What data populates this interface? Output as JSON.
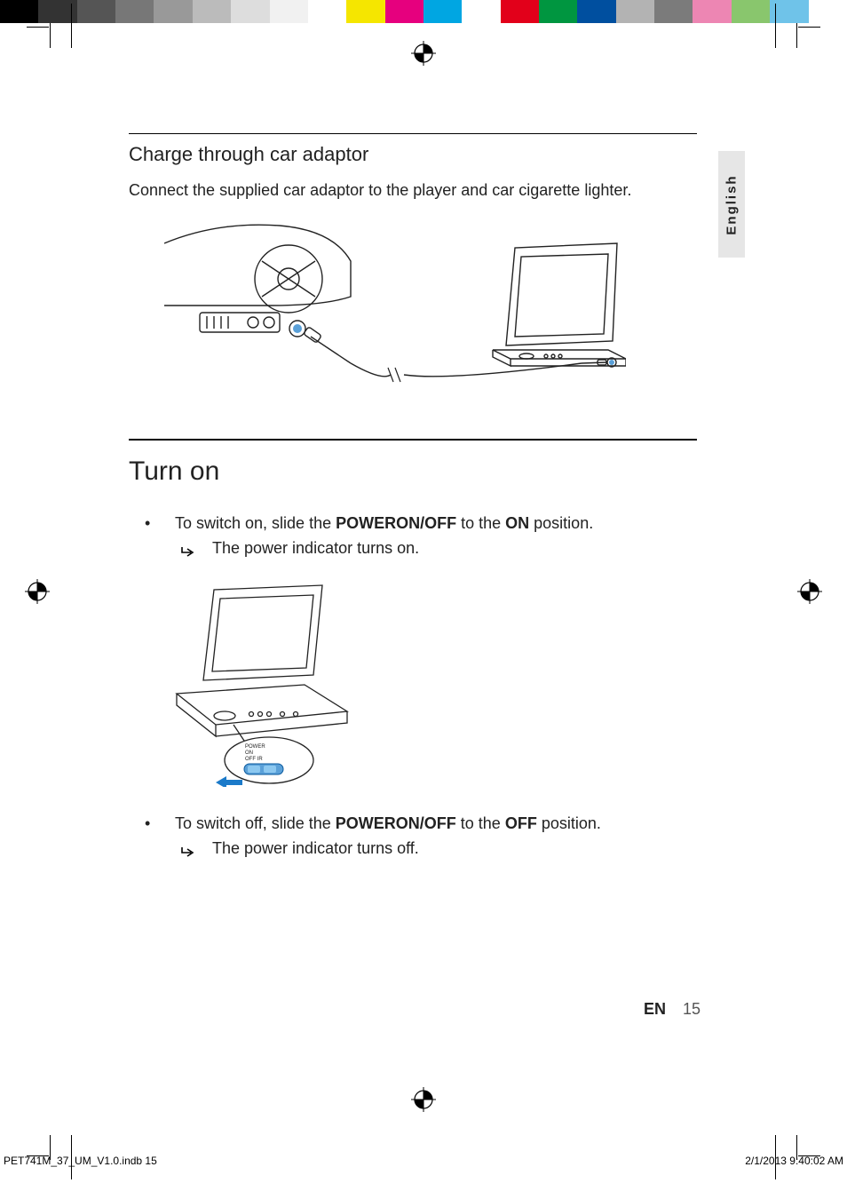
{
  "color_bar": [
    "#000000",
    "#333333",
    "#555555",
    "#777777",
    "#999999",
    "#bbbbbb",
    "#dddddd",
    "#f1f1f1",
    "#ffffff",
    "#f5e600",
    "#e6007e",
    "#00a6e2",
    "#ffffff",
    "#e2001a",
    "#009640",
    "#004f9f",
    "#b3b3b3",
    "#7b7b7b",
    "#ed86b3",
    "#89c66d",
    "#6fc3e9",
    "#ffffff"
  ],
  "section1": {
    "title": "Charge through car adaptor",
    "text": "Connect the supplied car adaptor to the player and car cigarette lighter."
  },
  "section2": {
    "title": "Turn on",
    "bullet1_pre": "To switch on, slide the ",
    "bullet1_kw1": "POWER",
    "bullet1_mid1": "",
    "bullet1_kw2": "ON/OFF",
    "bullet1_mid2": " to the ",
    "bullet1_kw3": "ON",
    "bullet1_post": " position.",
    "sub1": "The power indicator turns on.",
    "bullet2_pre": "To switch off, slide the ",
    "bullet2_kw1": "POWER",
    "bullet2_kw2": "ON/OFF",
    "bullet2_mid2": " to the ",
    "bullet2_kw3": "OFF",
    "bullet2_post": " position.",
    "sub2": "The power indicator turns off."
  },
  "side_tab": "English",
  "footer": {
    "lang": "EN",
    "page": "15"
  },
  "print_footer": {
    "left": "PET741M_37_UM_V1.0.indb   15",
    "right": "2/1/2013   9:40:02 AM"
  },
  "fig2_labels": {
    "l1": "POWER",
    "l2": "ON",
    "l3": "OFF IR"
  }
}
